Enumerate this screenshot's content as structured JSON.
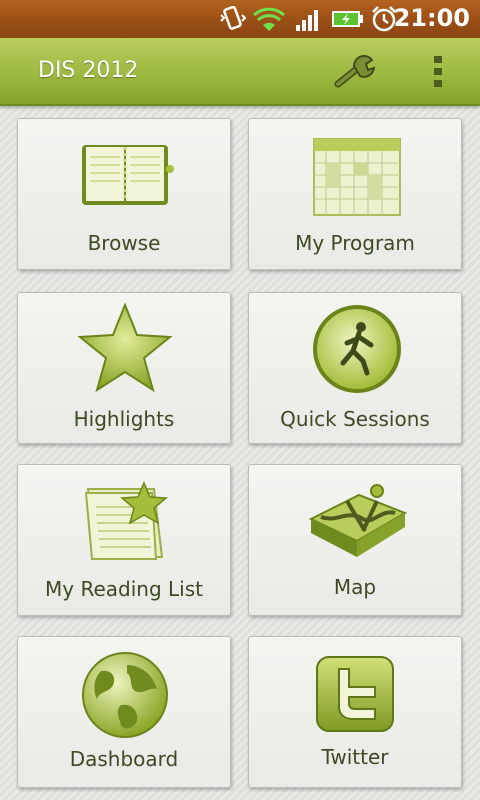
{
  "status_bar": {
    "time": "21:00",
    "icons": [
      "vibrate-icon",
      "wifi-icon",
      "signal-icon",
      "battery-charging-icon",
      "alarm-icon"
    ]
  },
  "action_bar": {
    "title": "DIS 2012",
    "settings_icon": "wrench-icon",
    "overflow_icon": "overflow-menu-icon"
  },
  "colors": {
    "accent_green": "#9cb941",
    "status_bar_brown": "#9a4f16",
    "label_text": "#3d4a23"
  },
  "tiles": [
    {
      "label": "Browse",
      "icon": "book-icon"
    },
    {
      "label": "My Program",
      "icon": "calendar-icon"
    },
    {
      "label": "Highlights",
      "icon": "star-icon"
    },
    {
      "label": "Quick Sessions",
      "icon": "runner-icon"
    },
    {
      "label": "My Reading List",
      "icon": "reading-list-icon"
    },
    {
      "label": "Map",
      "icon": "map-icon"
    },
    {
      "label": "Dashboard",
      "icon": "globe-icon"
    },
    {
      "label": "Twitter",
      "icon": "twitter-icon"
    }
  ]
}
